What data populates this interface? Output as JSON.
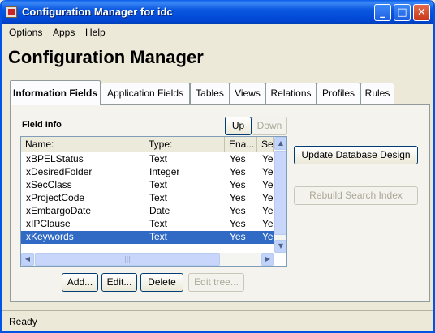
{
  "window": {
    "title": "Configuration Manager for idc"
  },
  "menu": [
    "Options",
    "Apps",
    "Help"
  ],
  "app_title": "Configuration Manager",
  "tabs": [
    "Information Fields",
    "Application Fields",
    "Tables",
    "Views",
    "Relations",
    "Profiles",
    "Rules"
  ],
  "active_tab": "Information Fields",
  "field_info": {
    "label": "Field Info",
    "up_label": "Up",
    "down_label": "Down",
    "columns": [
      "Name:",
      "Type:",
      "Ena...",
      "Se"
    ],
    "rows": [
      [
        "xBPELStatus",
        "Text",
        "Yes",
        "Ye"
      ],
      [
        "xDesiredFolder",
        "Integer",
        "Yes",
        "Ye"
      ],
      [
        "xSecClass",
        "Text",
        "Yes",
        "Ye"
      ],
      [
        "xProjectCode",
        "Text",
        "Yes",
        "Ye"
      ],
      [
        "xEmbargoDate",
        "Date",
        "Yes",
        "Ye"
      ],
      [
        "xIPClause",
        "Text",
        "Yes",
        "Ye"
      ],
      [
        "xKeywords",
        "Text",
        "Yes",
        "Ye"
      ]
    ],
    "selected_row": "xKeywords"
  },
  "actions": {
    "add": "Add...",
    "edit": "Edit...",
    "delete": "Delete",
    "edit_tree": "Edit tree...",
    "update_db": "Update Database Design",
    "rebuild_index": "Rebuild Search Index"
  },
  "status": "Ready",
  "colors": {
    "titlebar": "#0054e3",
    "selection": "#316ac5",
    "face": "#ece9d8"
  }
}
